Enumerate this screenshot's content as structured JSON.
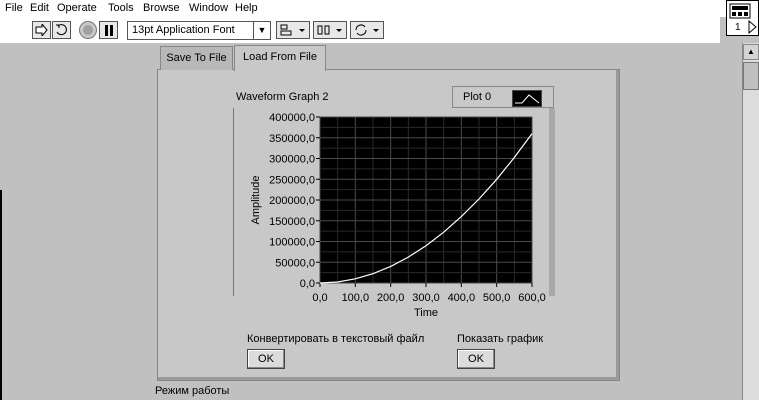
{
  "menu": [
    "File",
    "Edit",
    "Operate",
    "Tools",
    "Browse",
    "Window",
    "Help"
  ],
  "toolbar": {
    "font_select": "13pt Application Font",
    "vi_icon_number": "1"
  },
  "tabs": [
    {
      "label": "Save To File",
      "selected": false
    },
    {
      "label": "Load From File",
      "selected": true
    }
  ],
  "graph": {
    "title": "Waveform Graph 2",
    "legend_label": "Plot 0",
    "ylabel": "Amplitude",
    "xlabel": "Time"
  },
  "chart_data": {
    "type": "line",
    "title": "Waveform Graph 2",
    "xlabel": "Time",
    "ylabel": "Amplitude",
    "xlim": [
      0,
      600
    ],
    "ylim": [
      0,
      400000
    ],
    "x_ticks": [
      "0,0",
      "100,0",
      "200,0",
      "300,0",
      "400,0",
      "500,0",
      "600,0"
    ],
    "y_ticks": [
      "0,0",
      "50000,0",
      "100000,0",
      "150000,0",
      "200000,0",
      "250000,0",
      "300000,0",
      "350000,0",
      "400000,0"
    ],
    "grid": true,
    "legend": "top-right",
    "series": [
      {
        "name": "Plot 0",
        "color": "#ffffff",
        "x": [
          0,
          50,
          100,
          150,
          200,
          250,
          300,
          350,
          400,
          450,
          500,
          550,
          600
        ],
        "y": [
          0,
          2500,
          10000,
          22500,
          40000,
          62500,
          90000,
          122500,
          160000,
          202500,
          250000,
          302500,
          360000
        ]
      }
    ]
  },
  "controls": {
    "convert_label": "Конвертировать в текстовый файл",
    "convert_button": "OK",
    "show_label": "Показать график",
    "show_button": "OK"
  },
  "mode_label": "Режим работы"
}
